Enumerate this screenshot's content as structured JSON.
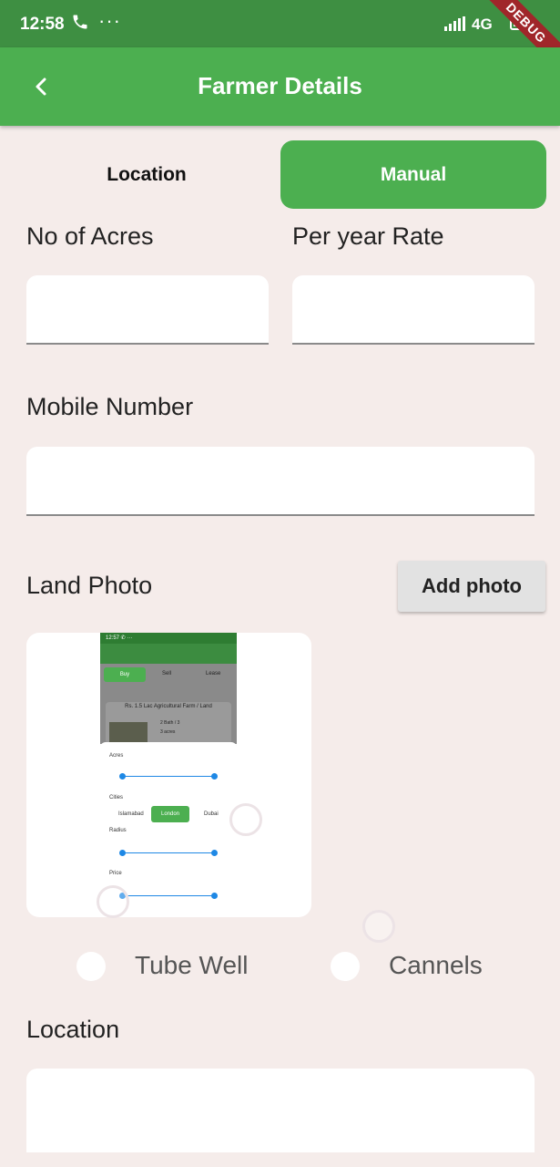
{
  "status_bar": {
    "time": "12:58",
    "dots": "···",
    "network": "4G",
    "debug_label": "DEBUG"
  },
  "app_bar": {
    "title": "Farmer Details"
  },
  "segments": {
    "location": "Location",
    "manual": "Manual"
  },
  "form": {
    "acres_label": "No of Acres",
    "rate_label": "Per year Rate",
    "mobile_label": "Mobile Number",
    "land_photo_label": "Land Photo",
    "add_photo_button": "Add photo",
    "location_label": "Location"
  },
  "water_source": {
    "options": [
      "Tube Well",
      "Cannels"
    ]
  },
  "thumbnail": {
    "statusbar_left": "12:57 ✆ ···",
    "tabs": [
      "Buy",
      "Sell",
      "Lease"
    ],
    "listing_title": "Rs. 1.5 Lac Agricultural Farm / Land",
    "listing_lines": [
      "2 Bath / 3",
      "3 acres",
      "1 months"
    ],
    "filter_labels": [
      "Acres",
      "Cities",
      "Radius",
      "Price"
    ],
    "cities": [
      "Islamabad",
      "London",
      "Dubai"
    ]
  },
  "colors": {
    "primary": "#4caf50",
    "status_bar": "#3e8f42",
    "background": "#f5ecea"
  }
}
